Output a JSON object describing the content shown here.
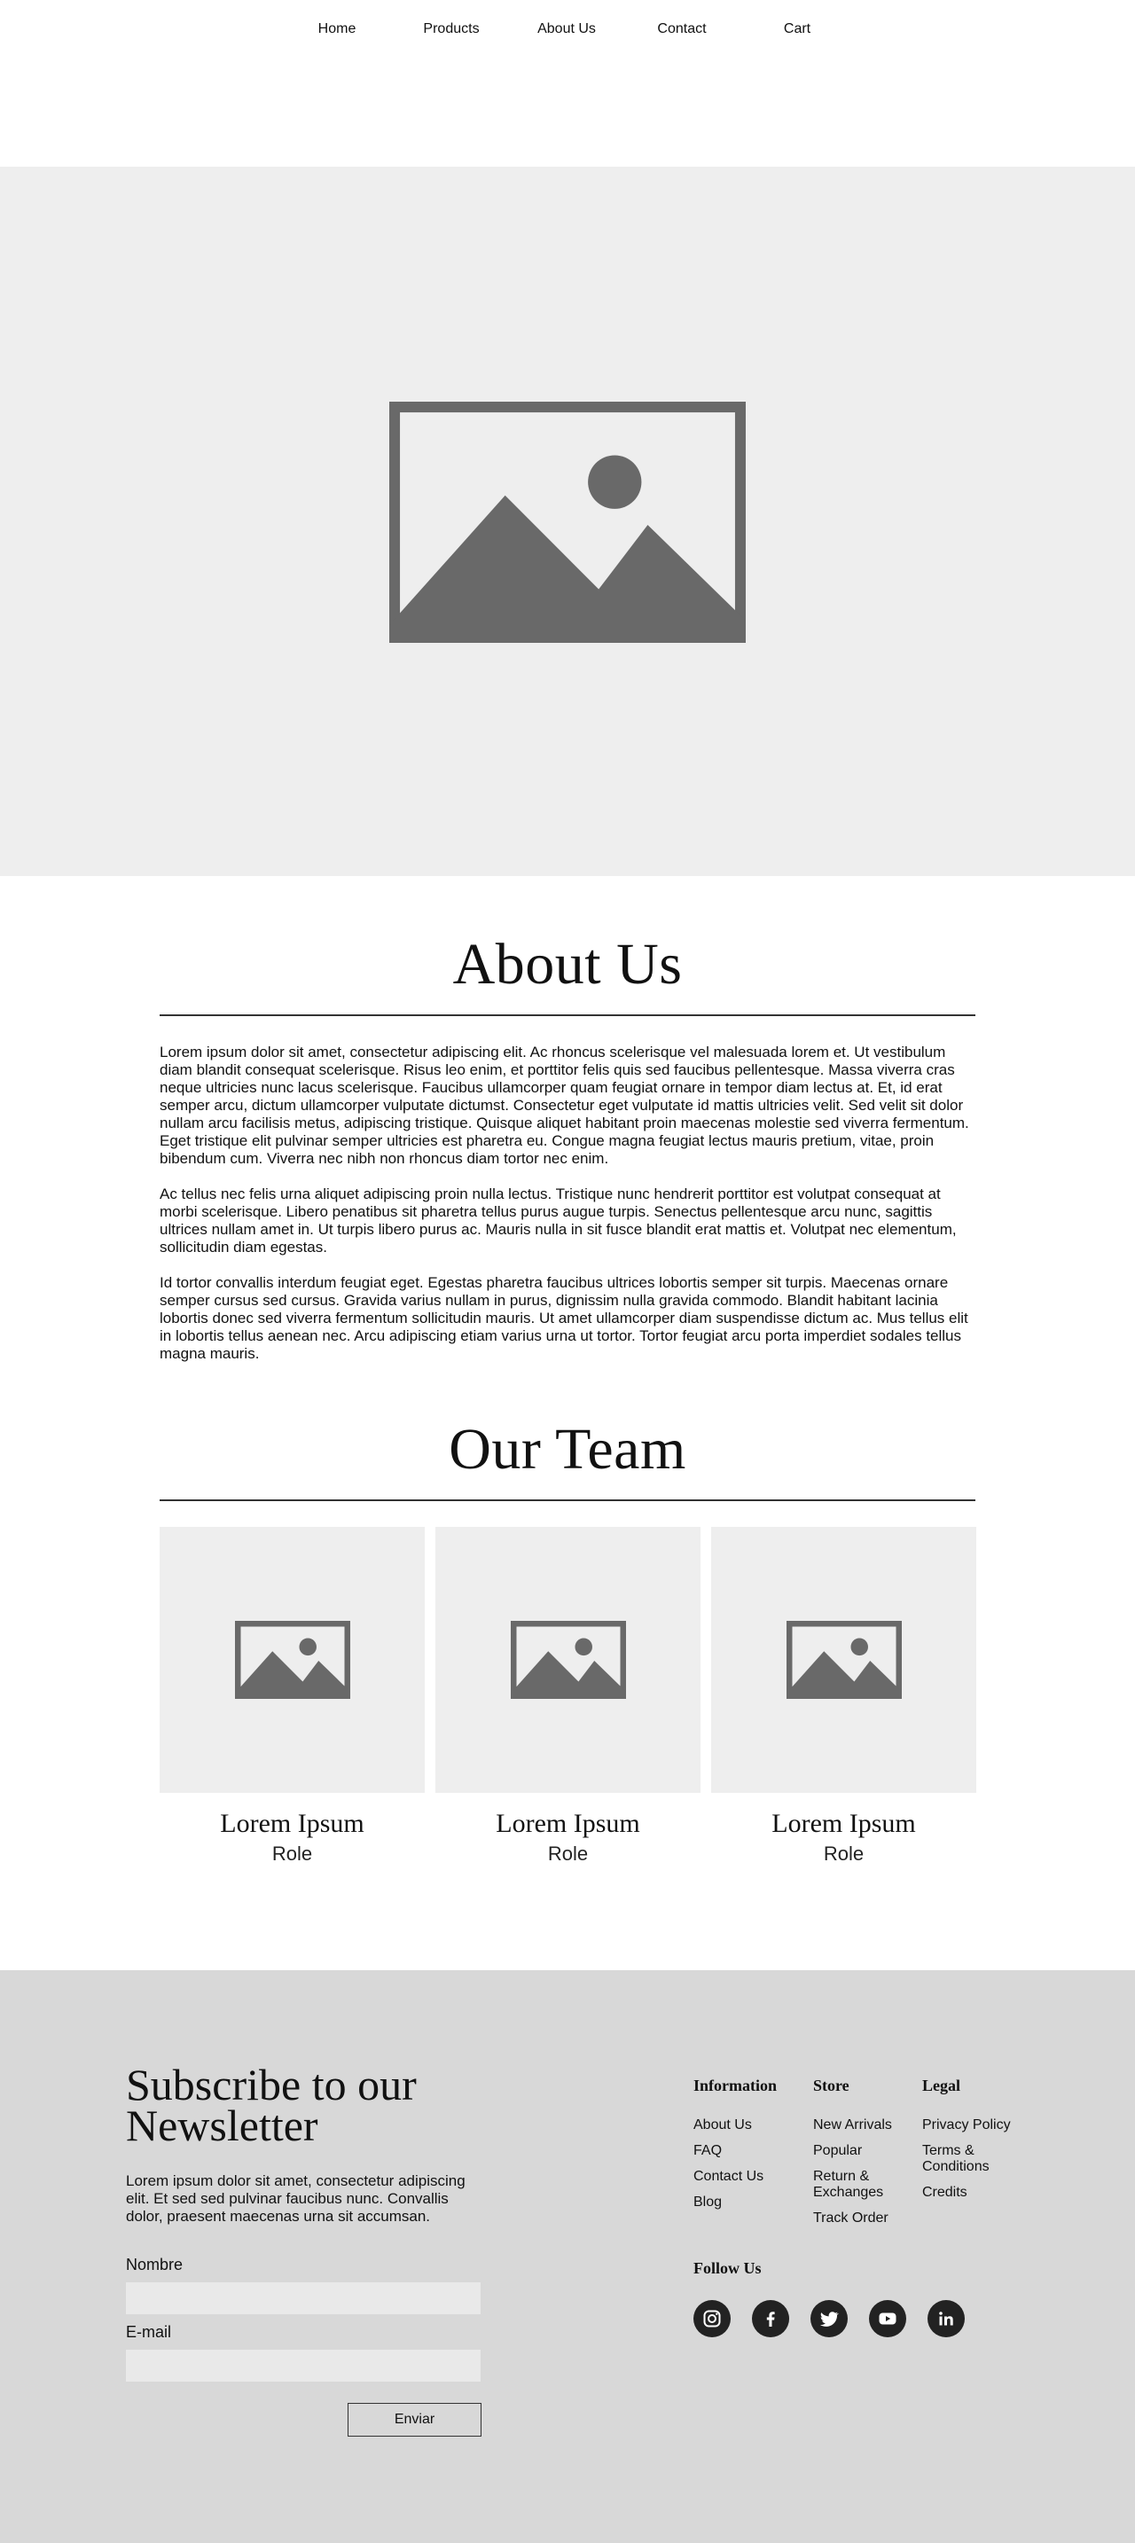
{
  "nav": {
    "items": [
      {
        "label": "Home"
      },
      {
        "label": "Products"
      },
      {
        "label": "About Us"
      },
      {
        "label": "Contact"
      },
      {
        "label": "Cart"
      }
    ]
  },
  "hero": {
    "icon": "image-placeholder-icon"
  },
  "about": {
    "title": "About Us",
    "paragraphs": [
      "Lorem ipsum dolor sit amet, consectetur adipiscing elit. Ac rhoncus scelerisque vel malesuada lorem et. Ut vestibulum diam blandit consequat scelerisque. Risus leo enim, et porttitor felis quis sed faucibus pellentesque. Massa viverra cras neque ultricies nunc lacus scelerisque. Faucibus ullamcorper quam feugiat ornare in tempor diam lectus at. Et, id erat semper arcu, dictum ullamcorper vulputate dictumst. Consectetur eget vulputate id mattis ultricies velit. Sed velit sit dolor nullam arcu facilisis metus, adipiscing tristique. Quisque aliquet habitant proin maecenas molestie sed viverra fermentum. Eget tristique elit pulvinar semper ultricies est pharetra eu. Congue magna feugiat lectus mauris pretium, vitae, proin bibendum cum. Viverra nec nibh non rhoncus diam tortor nec enim.",
      "Ac tellus nec felis urna aliquet adipiscing proin nulla lectus. Tristique nunc hendrerit porttitor est volutpat consequat at morbi scelerisque. Libero penatibus sit pharetra tellus purus augue turpis. Senectus pellentesque arcu nunc, sagittis ultrices nullam amet in. Ut turpis libero purus ac. Mauris nulla in sit fusce blandit erat mattis et. Volutpat nec elementum, sollicitudin diam egestas.",
      "Id tortor convallis interdum feugiat eget. Egestas pharetra faucibus ultrices lobortis semper sit turpis. Maecenas ornare semper cursus sed cursus. Gravida varius nullam in purus, dignissim nulla gravida commodo. Blandit habitant lacinia lobortis donec sed viverra fermentum sollicitudin mauris. Ut amet ullamcorper diam suspendisse dictum ac. Mus tellus elit in lobortis tellus aenean nec. Arcu adipiscing etiam varius urna ut tortor. Tortor feugiat arcu porta imperdiet sodales tellus magna mauris."
    ]
  },
  "team": {
    "title": "Our Team",
    "members": [
      {
        "name": "Lorem Ipsum",
        "role": "Role"
      },
      {
        "name": "Lorem Ipsum",
        "role": "Role"
      },
      {
        "name": "Lorem Ipsum",
        "role": "Role"
      }
    ]
  },
  "footer": {
    "newsletter": {
      "title_line1": "Subscribe to our",
      "title_line2": "Newsletter",
      "text": "Lorem ipsum dolor sit amet, consectetur adipiscing elit. Et sed sed pulvinar faucibus nunc. Convallis dolor, praesent maecenas urna sit accumsan.",
      "name_label": "Nombre",
      "name_value": "",
      "email_label": "E-mail",
      "email_value": "",
      "submit_label": "Enviar"
    },
    "columns": [
      {
        "title": "Information",
        "items": [
          "About Us",
          "FAQ",
          "Contact Us",
          "Blog"
        ]
      },
      {
        "title": "Store",
        "items": [
          "New Arrivals",
          "Popular",
          "Return & Exchanges",
          "Track Order"
        ]
      },
      {
        "title": "Legal",
        "items": [
          "Privacy Policy",
          "Terms & Conditions",
          "Credits"
        ]
      }
    ],
    "follow_title": "Follow Us",
    "social": [
      "instagram-icon",
      "facebook-icon",
      "twitter-icon",
      "youtube-icon",
      "linkedin-icon"
    ]
  },
  "colors": {
    "hero_bg": "#eeeeee",
    "placeholder_icon": "#696969",
    "footer_bg": "#d8d8d8",
    "input_bg": "#e9e9e9",
    "social_bg": "#222222"
  }
}
